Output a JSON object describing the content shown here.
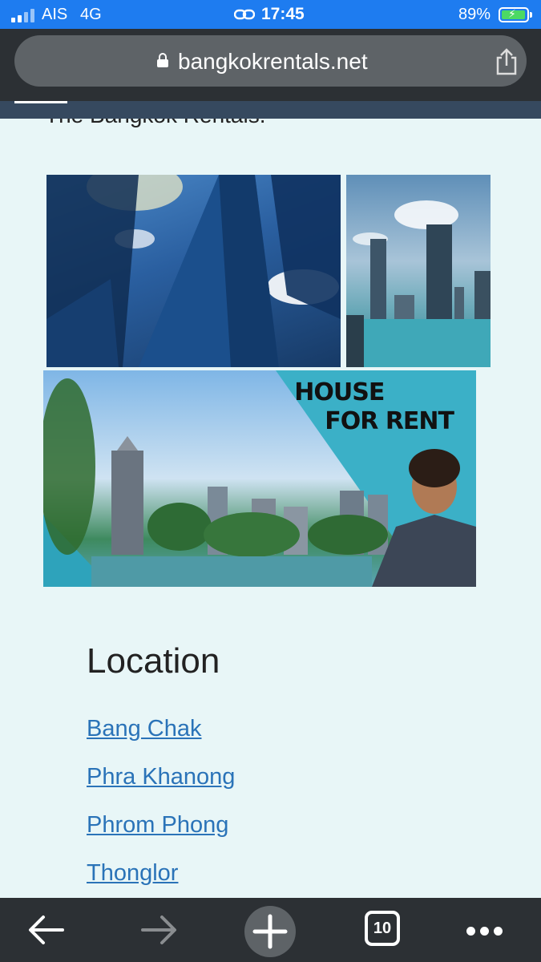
{
  "status_bar": {
    "carrier": "AIS",
    "network": "4G",
    "time": "17:45",
    "battery_percent": "89%",
    "battery_level": 0.89,
    "battery_state": "charging"
  },
  "browser": {
    "url": "bangkokrentals.net",
    "lock_icon": "lock-icon",
    "share_icon": "share-icon"
  },
  "page": {
    "intro_text_partial": "The Bangkok Rentals.",
    "banner": {
      "line1": "HOUSE",
      "line2": "FOR RENT"
    },
    "location_heading": "Location",
    "locations": [
      "Bang Chak",
      "Phra Khanong",
      "Phrom Phong",
      "Thonglor"
    ],
    "link_color": "#2a73b8"
  },
  "toolbar": {
    "back_icon": "arrow-left-icon",
    "forward_icon": "arrow-right-icon",
    "new_tab_icon": "plus-icon",
    "tab_count": "10",
    "more_icon": "more-dots-icon"
  },
  "colors": {
    "status_bar_bg": "#1e7cf0",
    "browser_bg": "#2c3034",
    "page_bg": "#e8f6f7"
  }
}
